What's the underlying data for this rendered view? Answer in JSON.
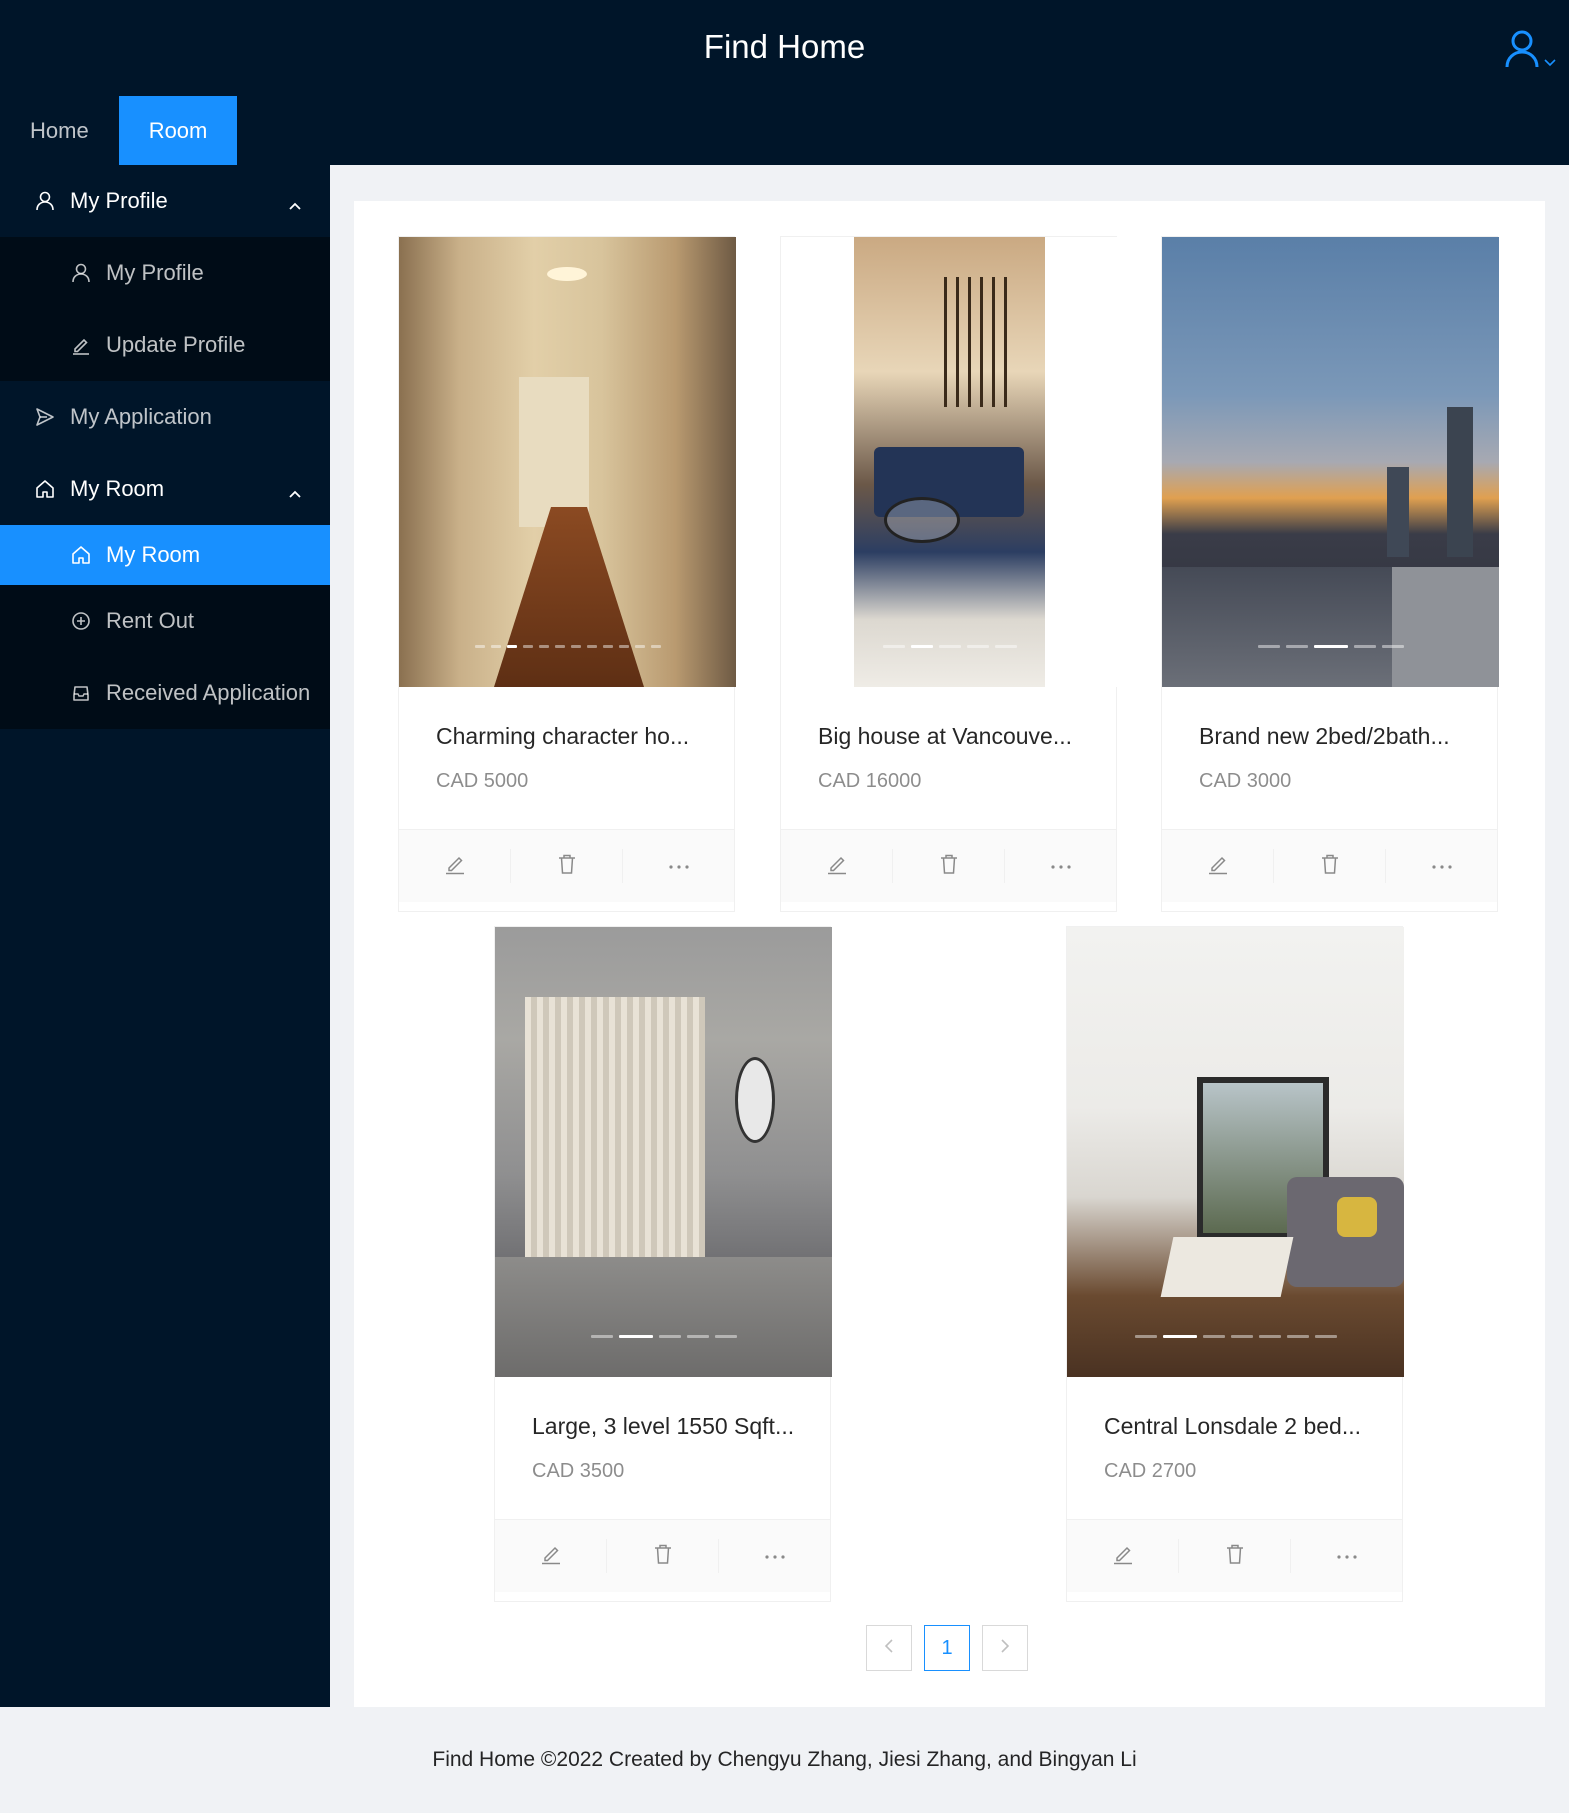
{
  "app": {
    "title": "Find Home"
  },
  "top_nav": [
    {
      "label": "Home",
      "active": false
    },
    {
      "label": "Room",
      "active": true
    }
  ],
  "sidebar": {
    "profile_group": {
      "label": "My Profile",
      "icon": "user-icon",
      "expanded": true
    },
    "profile_items": [
      {
        "label": "My Profile",
        "icon": "user-icon"
      },
      {
        "label": "Update Profile",
        "icon": "edit-icon"
      }
    ],
    "application": {
      "label": "My Application",
      "icon": "send-icon"
    },
    "room_group": {
      "label": "My Room",
      "icon": "home-icon",
      "expanded": true
    },
    "room_items": [
      {
        "label": "My Room",
        "icon": "home-icon",
        "selected": true
      },
      {
        "label": "Rent Out",
        "icon": "plus-circle-icon"
      },
      {
        "label": "Received Application",
        "icon": "inbox-icon"
      }
    ]
  },
  "rooms": [
    {
      "title": "Charming character ho...",
      "price": "CAD 5000"
    },
    {
      "title": "Big house at Vancouve...",
      "price": "CAD 16000"
    },
    {
      "title": "Brand new 2bed/2bath...",
      "price": "CAD 3000"
    },
    {
      "title": "Large, 3 level 1550 Sqft...",
      "price": "CAD 3500"
    },
    {
      "title": "Central Lonsdale 2 bed...",
      "price": "CAD 2700"
    }
  ],
  "pagination": {
    "current": "1"
  },
  "footer": {
    "text": "Find Home ©2022 Created by Chengyu Zhang, Jiesi Zhang, and Bingyan Li"
  },
  "colors": {
    "header": "#001529",
    "accent": "#1890ff",
    "submenu": "#000c17"
  }
}
